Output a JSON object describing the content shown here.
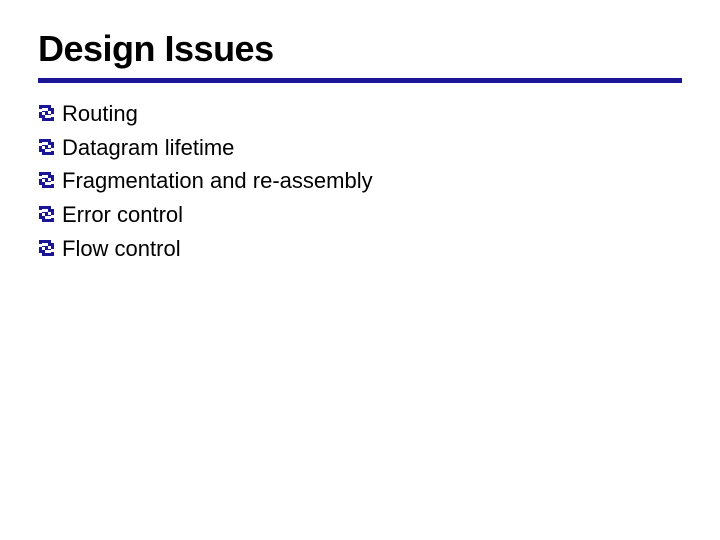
{
  "slide": {
    "title": "Design Issues",
    "bullets": [
      "Routing",
      "Datagram lifetime",
      "Fragmentation and re-assembly",
      "Error control",
      "Flow control"
    ]
  }
}
